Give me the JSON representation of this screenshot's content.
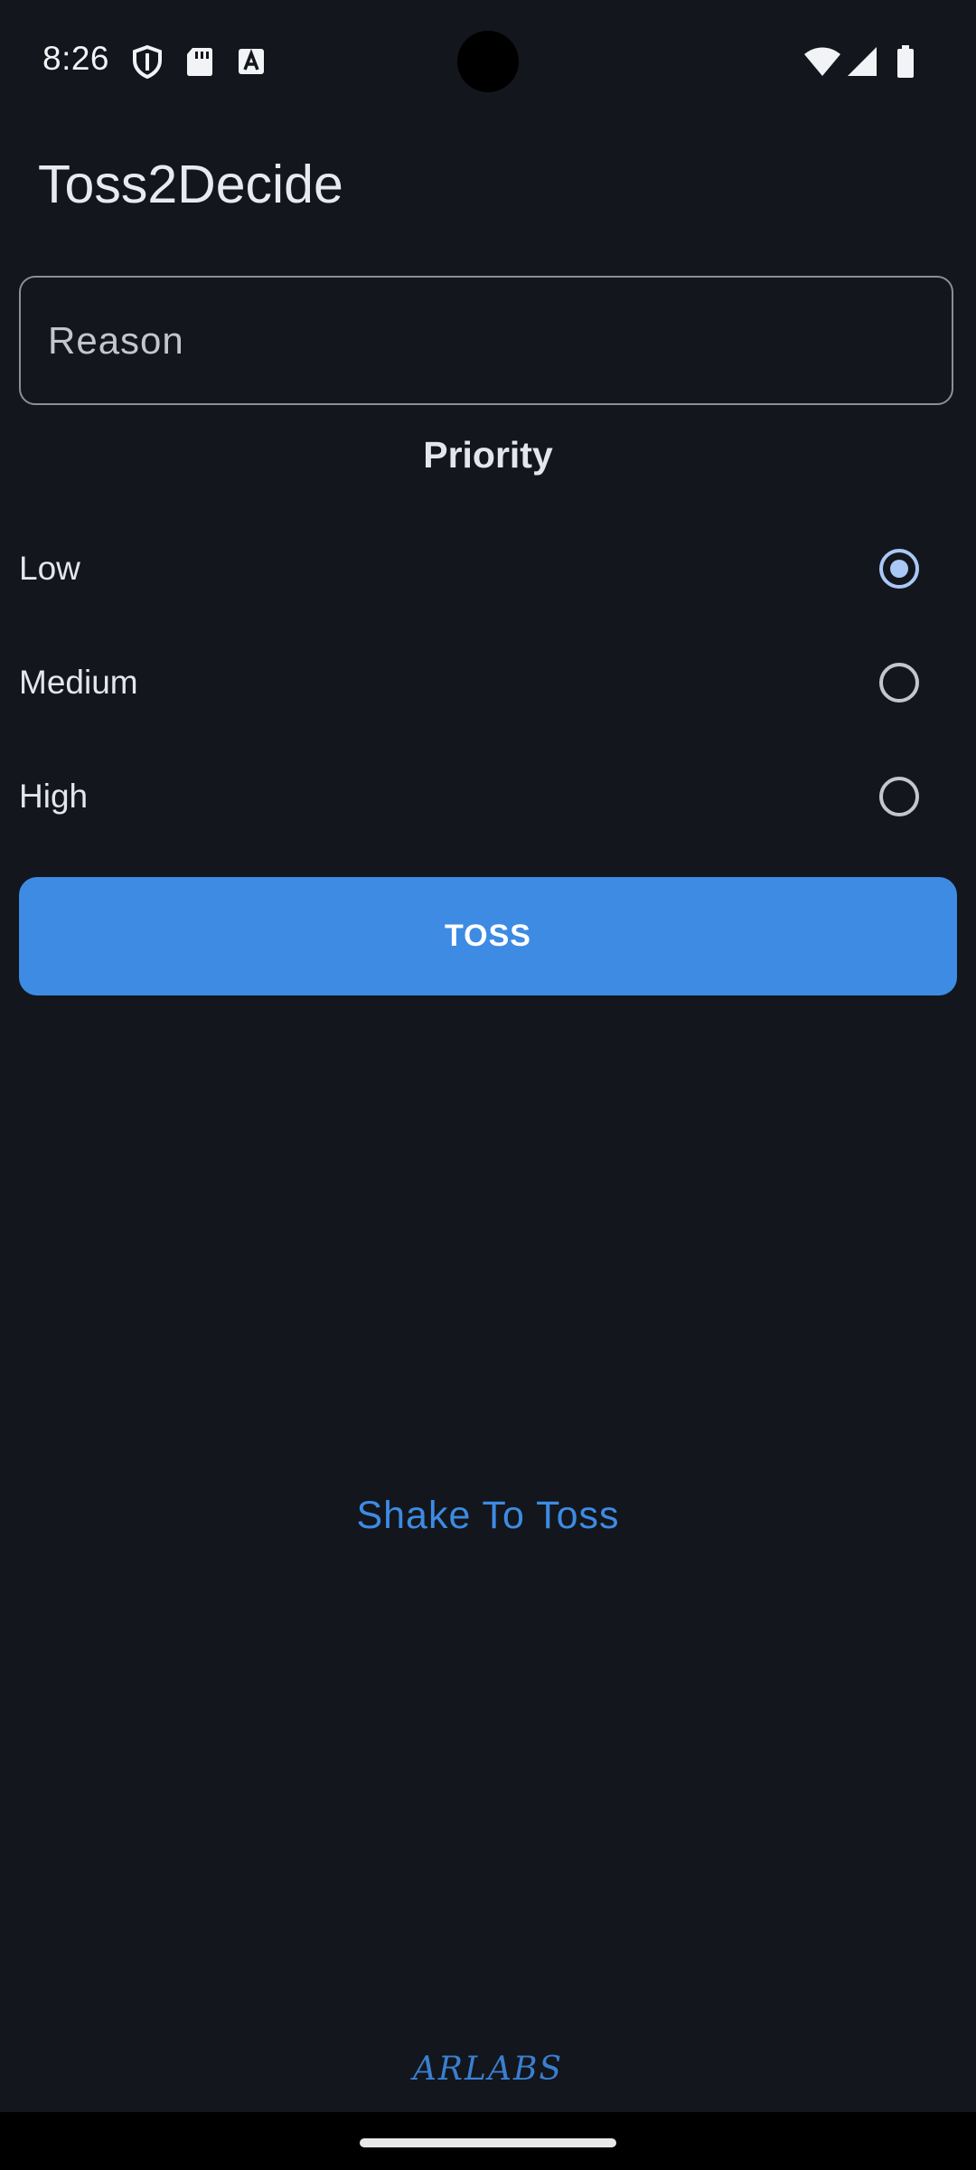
{
  "status_bar": {
    "time": "8:26",
    "left_icons": [
      "shield-icon",
      "sd-card-icon",
      "font-a-icon"
    ],
    "right_icons": [
      "wifi-icon",
      "cell-signal-icon",
      "battery-icon"
    ]
  },
  "app": {
    "title": "Toss2Decide"
  },
  "reason": {
    "placeholder": "Reason",
    "value": ""
  },
  "priority": {
    "heading": "Priority",
    "options": [
      {
        "label": "Low",
        "selected": true
      },
      {
        "label": "Medium",
        "selected": false
      },
      {
        "label": "High",
        "selected": false
      }
    ]
  },
  "actions": {
    "toss_label": "TOSS",
    "shake_hint": "Shake To Toss"
  },
  "footer": {
    "brand": "ARLABS"
  },
  "colors": {
    "background": "#13161c",
    "accent": "#3d8be3",
    "radio_selected": "#a9c8f6",
    "text": "#e4e6ec"
  }
}
